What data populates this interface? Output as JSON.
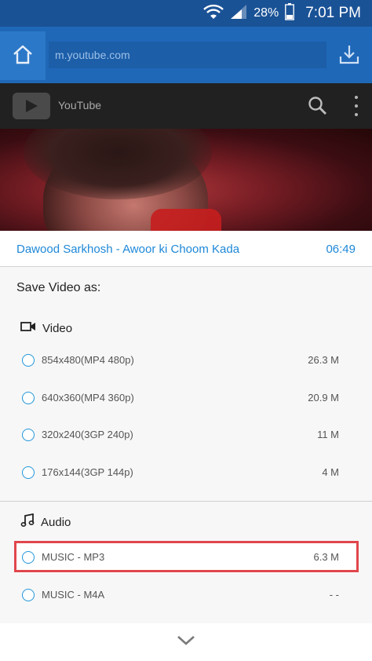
{
  "status_bar": {
    "battery_percent": "28%",
    "time": "7:01 PM",
    "icons": [
      "wifi-icon",
      "signal-icon",
      "battery-icon"
    ]
  },
  "browser": {
    "url": "m.youtube.com",
    "icons": [
      "home-icon",
      "download-icon"
    ]
  },
  "youtube_header": {
    "title": "YouTube",
    "icons": [
      "youtube-logo-icon",
      "search-icon",
      "more-vert-icon"
    ]
  },
  "sheet": {
    "video_title": "Dawood Sarkhosh - Awoor ki Choom Kada",
    "duration": "06:49",
    "save_as_label": "Save Video as:",
    "video_section": {
      "label": "Video",
      "icon": "videocam-icon",
      "options": [
        {
          "label": "854x480(MP4 480p)",
          "size": "26.3 M"
        },
        {
          "label": "640x360(MP4 360p)",
          "size": "20.9 M"
        },
        {
          "label": "320x240(3GP 240p)",
          "size": "11 M"
        },
        {
          "label": "176x144(3GP 144p)",
          "size": "4 M"
        }
      ]
    },
    "audio_section": {
      "label": "Audio",
      "icon": "music-note-icon",
      "options": [
        {
          "label": "MUSIC - MP3",
          "size": "6.3 M",
          "highlighted": true
        },
        {
          "label": "MUSIC - M4A",
          "size": "- -"
        }
      ]
    },
    "collapse_icon": "chevron-down-icon"
  },
  "colors": {
    "status_bar": "#1a5296",
    "browser_bar": "#1f68b8",
    "accent": "#1e88d8",
    "highlight": "#e0474c"
  }
}
